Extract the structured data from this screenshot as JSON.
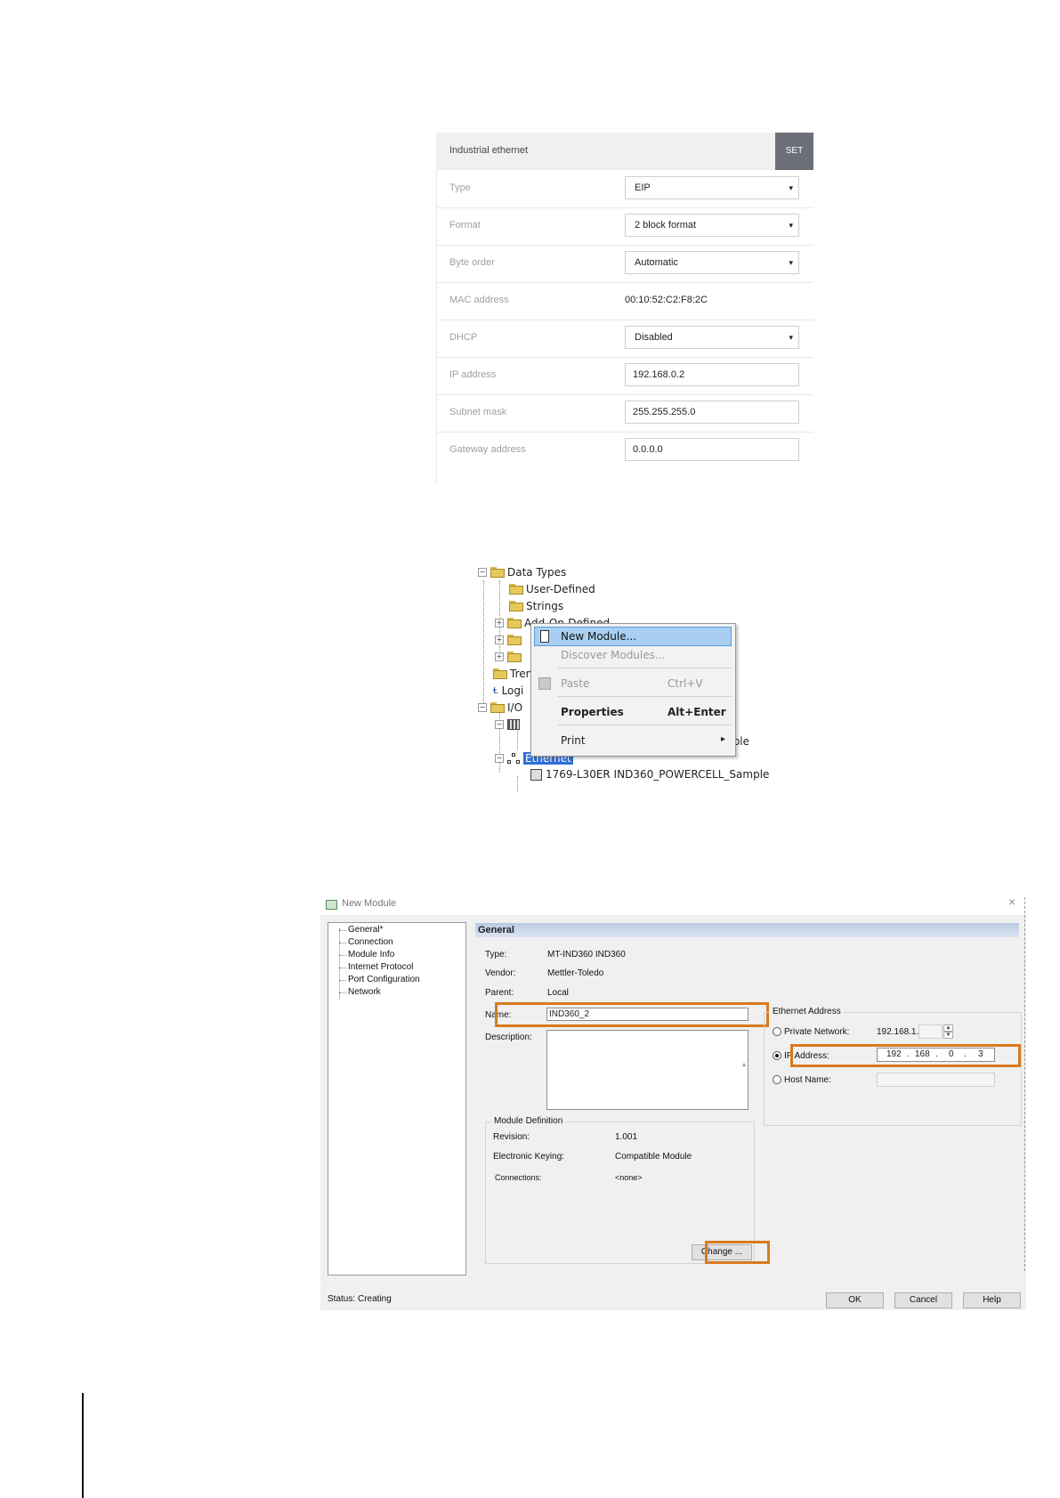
{
  "industrial_ethernet": {
    "title": "Industrial ethernet",
    "set_button": "SET",
    "rows": [
      {
        "label": "Type",
        "value": "EIP",
        "kind": "select"
      },
      {
        "label": "Format",
        "value": "2 block format",
        "kind": "select"
      },
      {
        "label": "Byte order",
        "value": "Automatic",
        "kind": "select"
      },
      {
        "label": "MAC address",
        "value": "00:10:52:C2:F8:2C",
        "kind": "text"
      },
      {
        "label": "DHCP",
        "value": "Disabled",
        "kind": "select"
      },
      {
        "label": "IP address",
        "value": "192.168.0.2",
        "kind": "input"
      },
      {
        "label": "Subnet mask",
        "value": "255.255.255.0",
        "kind": "input"
      },
      {
        "label": "Gateway address",
        "value": "0.0.0.0",
        "kind": "input"
      }
    ],
    "chevron": "▾"
  },
  "tree": {
    "data_types": "Data Types",
    "user_defined": "User-Defined",
    "strings": "Strings",
    "add_on_partial": "Add-On-Defined",
    "trends_partial": "Tren",
    "logical_partial": "Logi",
    "io_partial": "I/O",
    "sample_partial": "mple",
    "ethernet": "Ethernet",
    "controller_module": "1769-L30ER IND360_POWERCELL_Sample"
  },
  "context_menu": {
    "new_module": "New Module...",
    "discover_modules": "Discover Modules...",
    "paste": "Paste",
    "paste_shortcut": "Ctrl+V",
    "properties": "Properties",
    "properties_shortcut": "Alt+Enter",
    "print": "Print",
    "print_arrow": "▸"
  },
  "dialog": {
    "title": "New Module",
    "close": "×",
    "nav": [
      "General*",
      "Connection",
      "Module Info",
      "Internet Protocol",
      "Port Configuration",
      "Network"
    ],
    "section_header": "General",
    "type_label": "Type:",
    "type_value": "MT-IND360 IND360",
    "vendor_label": "Vendor:",
    "vendor_value": "Mettler-Toledo",
    "parent_label": "Parent:",
    "parent_value": "Local",
    "name_label": "Name:",
    "name_value": "IND360_2",
    "description_label": "Description:",
    "ethernet_address_title": "Ethernet Address",
    "private_network_label": "Private Network:",
    "private_network_prefix": "192.168.1.",
    "ip_address_label": "IP Address:",
    "ip_octets": [
      "192",
      "168",
      "0",
      "3"
    ],
    "host_name_label": "Host Name:",
    "module_definition_title": "Module Definition",
    "revision_label": "Revision:",
    "revision_value": "1.001",
    "keying_label": "Electronic Keying:",
    "keying_value": "Compatible Module",
    "connections_label": "Connections:",
    "connections_value": "<none>",
    "change_button": "Change ...",
    "status_label": "Status:",
    "status_value": "Creating",
    "ok_button": "OK",
    "cancel_button": "Cancel",
    "help_button": "Help"
  },
  "colors": {
    "highlight": "#d97a1f",
    "set_button_bg": "#6d6f78",
    "menu_selection": "#a8cff2"
  },
  "icons": [
    "folder-icon",
    "network-icon",
    "module-icon",
    "controller-icon",
    "paste-icon",
    "new-module-icon"
  ]
}
